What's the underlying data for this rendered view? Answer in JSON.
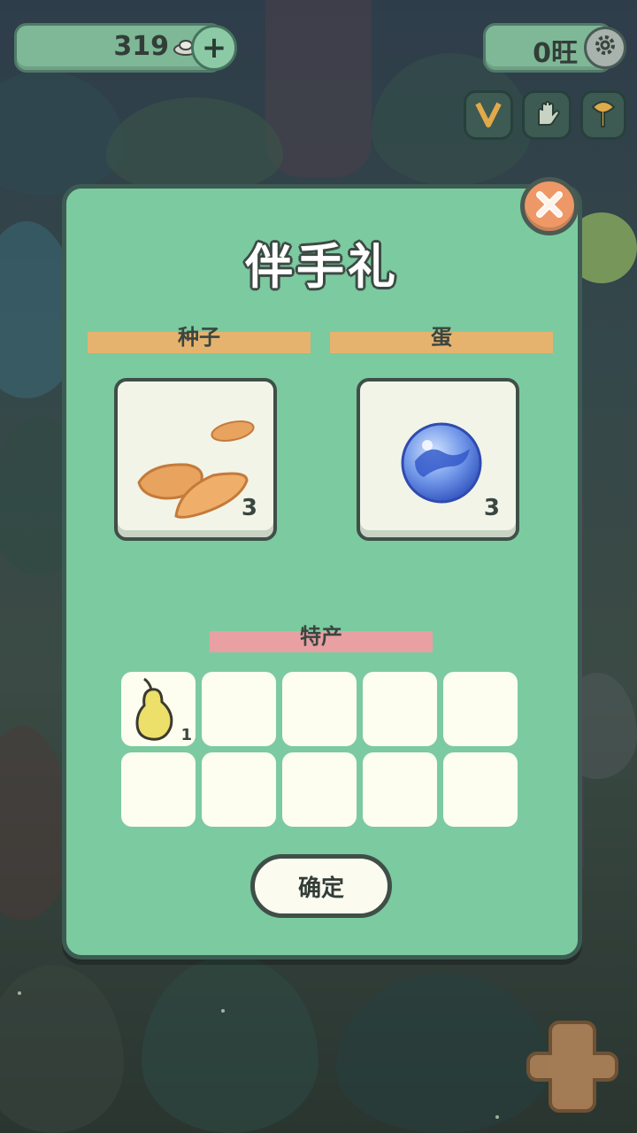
{
  "top_bar": {
    "currency_amount": "319",
    "add_label": "+",
    "wang_count": "0旺"
  },
  "side_buttons": [
    "v-icon",
    "hand-icon",
    "ginkgo-leaf-icon"
  ],
  "modal": {
    "title": "伴手礼",
    "close_icon": "close-icon",
    "sections": {
      "seeds": {
        "label": "种子",
        "item_icon": "seed-icon",
        "count": "3",
        "bar_color": "#e6b36f"
      },
      "egg": {
        "label": "蛋",
        "item_icon": "blue-egg-icon",
        "count": "3",
        "bar_color": "#e6b36f"
      },
      "specialty": {
        "label": "特产",
        "bar_color": "#e8a0a3",
        "items": [
          {
            "icon": "pear-icon",
            "count": "1"
          },
          {},
          {},
          {},
          {},
          {},
          {},
          {},
          {},
          {}
        ]
      }
    },
    "confirm_label": "确定"
  },
  "colors": {
    "modal_bg": "#7ccaa0",
    "modal_border": "#3d5b52",
    "close_bg": "#ee9867",
    "slot_bg": "#fdfdf0"
  }
}
